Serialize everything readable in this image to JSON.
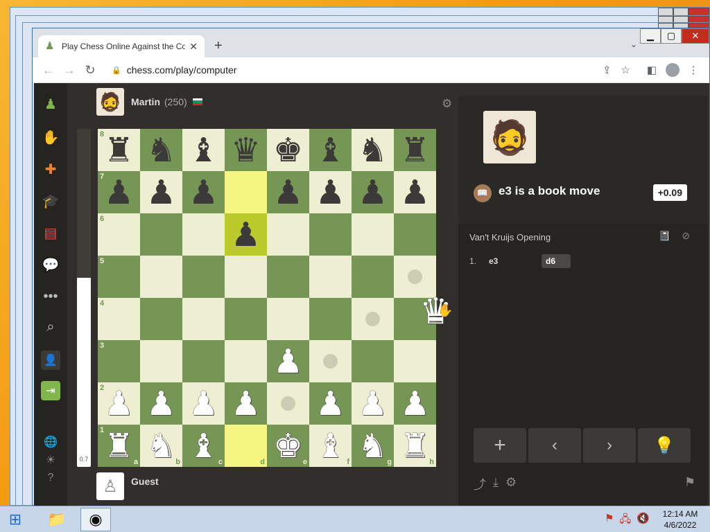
{
  "window": {
    "tab_title": "Play Chess Online Against the Co",
    "url": "chess.com/play/computer"
  },
  "nav": {
    "items": [
      "logo-pawn-icon",
      "play-icon",
      "puzzles-icon",
      "learn-icon",
      "news-icon",
      "social-icon",
      "more-icon",
      "search-icon",
      "add-friend-icon",
      "signup-icon",
      "language-icon",
      "theme-icon",
      "help-icon"
    ]
  },
  "players": {
    "top": {
      "name": "Martin",
      "rating": "(250)",
      "flag_colors": [
        "#ffffff",
        "#00966e",
        "#d62612"
      ]
    },
    "bottom": {
      "name": "Guest"
    }
  },
  "eval": {
    "value": "0.7",
    "white_fraction": 0.56
  },
  "board": {
    "files": [
      "a",
      "b",
      "c",
      "d",
      "e",
      "f",
      "g",
      "h"
    ],
    "ranks": [
      "8",
      "7",
      "6",
      "5",
      "4",
      "3",
      "2",
      "1"
    ],
    "pieces": {
      "a8": "bR",
      "b8": "bN",
      "c8": "bB",
      "d8": "bQ",
      "e8": "bK",
      "f8": "bB",
      "g8": "bN",
      "h8": "bR",
      "a7": "bP",
      "b7": "bP",
      "c7": "bP",
      "e7": "bP",
      "f7": "bP",
      "g7": "bP",
      "h7": "bP",
      "d6": "bP",
      "e3": "wP",
      "a2": "wP",
      "b2": "wP",
      "c2": "wP",
      "d2": "wP",
      "f2": "wP",
      "g2": "wP",
      "h2": "wP",
      "a1": "wR",
      "b1": "wN",
      "c1": "wB",
      "e1": "wK",
      "f1": "wB",
      "g1": "wN",
      "h1": "wR"
    },
    "highlights": [
      "d7",
      "d6",
      "d1"
    ],
    "hints": [
      "h5",
      "g4",
      "f3",
      "e2"
    ],
    "dragging_piece": "wQ"
  },
  "coach": {
    "move": "e3",
    "message": " is a book move",
    "evaluation": "+0.09"
  },
  "moves": {
    "opening": "Van't Kruijs Opening",
    "list": [
      {
        "num": "1.",
        "white": "e3",
        "black": "d6"
      }
    ]
  },
  "controls": [
    "+",
    "‹",
    "›",
    "💡"
  ],
  "taskbar": {
    "time": "12:14 AM",
    "date": "4/6/2022"
  },
  "colors": {
    "accent": "#81b64c",
    "light_square": "#eeeed2",
    "dark_square": "#769656"
  }
}
